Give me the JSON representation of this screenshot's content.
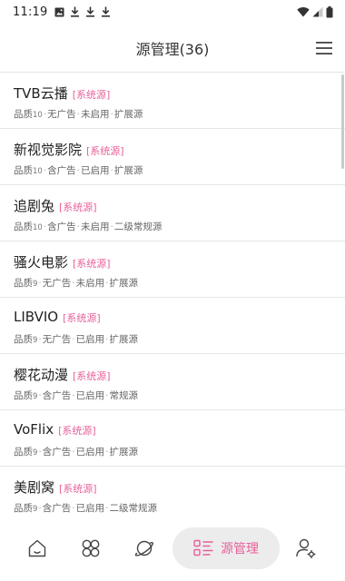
{
  "status_bar": {
    "time": "11:19",
    "left_icons": [
      "photo-icon",
      "download-icon",
      "download-icon",
      "download-icon"
    ],
    "right_icons": [
      "wifi-icon",
      "signal-icon",
      "battery-icon"
    ]
  },
  "header": {
    "title": "源管理(36)",
    "menu_icon": "hamburger-menu-icon"
  },
  "colors": {
    "accent": "#e8609a",
    "text_primary": "#222222",
    "text_secondary": "#666666",
    "divider": "#e6e6e6",
    "nav_active_bg": "#ececec"
  },
  "sources": [
    {
      "name": "TVB云播",
      "tag": "[系统源]",
      "quality_label": "品质",
      "quality": "10",
      "ads": "无广告",
      "status": "未启用",
      "type": "扩展源"
    },
    {
      "name": "新视觉影院",
      "tag": "[系统源]",
      "quality_label": "品质",
      "quality": "10",
      "ads": "含广告",
      "status": "已启用",
      "type": "扩展源"
    },
    {
      "name": "追剧兔",
      "tag": "[系统源]",
      "quality_label": "品质",
      "quality": "10",
      "ads": "含广告",
      "status": "未启用",
      "type": "二级常规源"
    },
    {
      "name": "骚火电影",
      "tag": "[系统源]",
      "quality_label": "品质",
      "quality": "9",
      "ads": "无广告",
      "status": "未启用",
      "type": "扩展源"
    },
    {
      "name": "LIBVIO",
      "tag": "[系统源]",
      "quality_label": "品质",
      "quality": "9",
      "ads": "无广告",
      "status": "已启用",
      "type": "扩展源"
    },
    {
      "name": "樱花动漫",
      "tag": "[系统源]",
      "quality_label": "品质",
      "quality": "9",
      "ads": "含广告",
      "status": "已启用",
      "type": "常规源"
    },
    {
      "name": "VoFlix",
      "tag": "[系统源]",
      "quality_label": "品质",
      "quality": "9",
      "ads": "含广告",
      "status": "已启用",
      "type": "扩展源"
    },
    {
      "name": "美剧窝",
      "tag": "[系统源]",
      "quality_label": "品质",
      "quality": "9",
      "ads": "含广告",
      "status": "已启用",
      "type": "二级常规源"
    }
  ],
  "bottom_nav": {
    "items": [
      {
        "icon": "home-icon",
        "label": ""
      },
      {
        "icon": "grid-flower-icon",
        "label": ""
      },
      {
        "icon": "planet-icon",
        "label": ""
      },
      {
        "icon": "list-icon",
        "label": "源管理",
        "active": true
      },
      {
        "icon": "user-settings-icon",
        "label": ""
      }
    ]
  }
}
